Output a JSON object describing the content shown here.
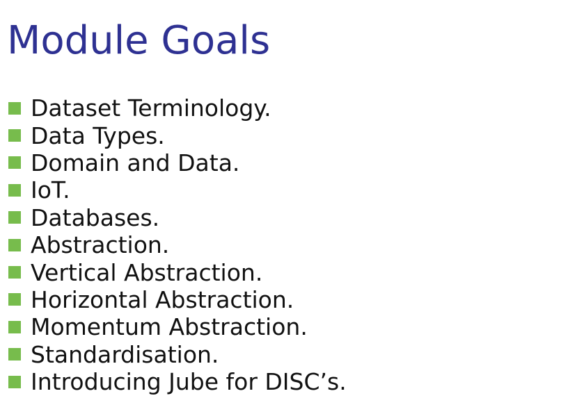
{
  "slide": {
    "title": "Module Goals",
    "bullet_color": "#77bc4c",
    "title_color": "#2e3192",
    "bullets": [
      {
        "text": "Dataset Terminology."
      },
      {
        "text": "Data Types."
      },
      {
        "text": "Domain and Data."
      },
      {
        "text": "IoT."
      },
      {
        "text": "Databases."
      },
      {
        "text": "Abstraction."
      },
      {
        "text": "Vertical Abstraction."
      },
      {
        "text": "Horizontal Abstraction."
      },
      {
        "text": "Momentum Abstraction."
      },
      {
        "text": "Standardisation."
      },
      {
        "text": "Introducing Jube for DISC’s."
      }
    ]
  }
}
